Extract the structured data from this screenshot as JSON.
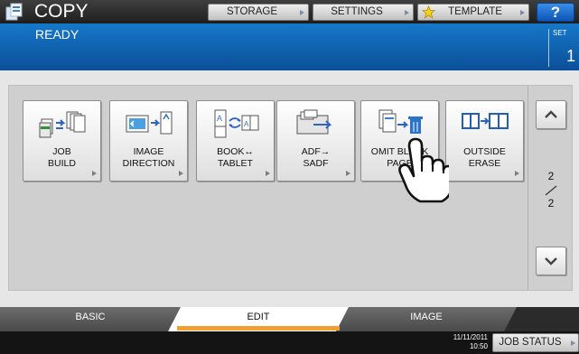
{
  "header": {
    "title": "COPY",
    "buttons": {
      "storage": "STORAGE",
      "settings": "SETTINGS",
      "template": "TEMPLATE",
      "help": "?"
    }
  },
  "status": {
    "message": "READY",
    "set_label": "SET",
    "set_value": "1"
  },
  "functions": [
    {
      "label": "JOB\nBUILD",
      "icon": "job-build-icon"
    },
    {
      "label": "IMAGE\nDIRECTION",
      "icon": "image-direction-icon"
    },
    {
      "label": "BOOK↔\nTABLET",
      "icon": "book-tablet-icon"
    },
    {
      "label": "ADF→\nSADF",
      "icon": "adf-sadf-icon"
    },
    {
      "label": "OMIT BLANK\nPAGE",
      "icon": "omit-blank-page-icon"
    },
    {
      "label": "OUTSIDE\nERASE",
      "icon": "outside-erase-icon"
    }
  ],
  "pagination": {
    "current": "2",
    "total": "2"
  },
  "tabs": {
    "basic": "BASIC",
    "edit": "EDIT",
    "image": "IMAGE"
  },
  "footer": {
    "date": "11/11/2011",
    "time": "10:50",
    "job_status": "JOB STATUS"
  },
  "colors": {
    "status_blue": "#0b5fb0",
    "help_blue": "#1a6fd4",
    "active_tab_accent": "#f0a030"
  }
}
